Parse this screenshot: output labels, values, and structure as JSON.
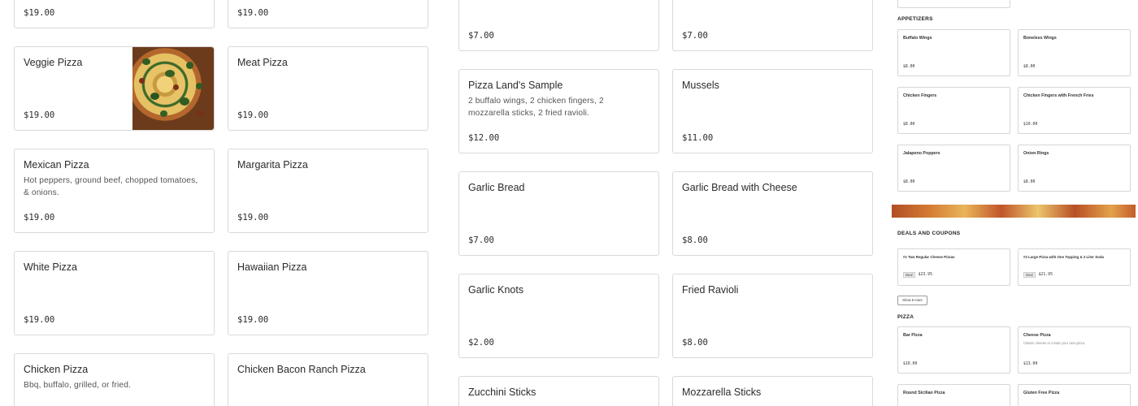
{
  "left_items": [
    {
      "name": "",
      "desc": "",
      "price": "$19.00"
    },
    {
      "name": "",
      "desc": "",
      "price": "$19.00"
    },
    {
      "name": "Veggie Pizza",
      "desc": "",
      "price": "$19.00"
    },
    {
      "name": "Meat Pizza",
      "desc": "",
      "price": "$19.00"
    },
    {
      "name": "Mexican Pizza",
      "desc": "Hot peppers, ground beef, chopped tomatoes, & onions.",
      "price": "$19.00"
    },
    {
      "name": "Margarita Pizza",
      "desc": "",
      "price": "$19.00"
    },
    {
      "name": "White Pizza",
      "desc": "",
      "price": "$19.00"
    },
    {
      "name": "Hawaiian Pizza",
      "desc": "",
      "price": "$19.00"
    },
    {
      "name": "Chicken Pizza",
      "desc": "Bbq, buffalo, grilled, or fried.",
      "price": ""
    },
    {
      "name": "Chicken Bacon Ranch Pizza",
      "desc": "",
      "price": ""
    }
  ],
  "middle_items": [
    {
      "name": "",
      "desc": "",
      "price": "$7.00"
    },
    {
      "name": "",
      "desc": "",
      "price": "$7.00"
    },
    {
      "name": "Pizza Land's Sample",
      "desc": "2 buffalo wings, 2 chicken fingers, 2 mozzarella sticks, 2 fried ravioli.",
      "price": "$12.00"
    },
    {
      "name": "Mussels",
      "desc": "",
      "price": "$11.00"
    },
    {
      "name": "Garlic Bread",
      "desc": "",
      "price": "$7.00"
    },
    {
      "name": "Garlic Bread with Cheese",
      "desc": "",
      "price": "$8.00"
    },
    {
      "name": "Garlic Knots",
      "desc": "",
      "price": "$2.00"
    },
    {
      "name": "Fried Ravioli",
      "desc": "",
      "price": "$8.00"
    },
    {
      "name": "Zucchini Sticks",
      "desc": "",
      "price": ""
    },
    {
      "name": "Mozzarella Sticks",
      "desc": "",
      "price": ""
    }
  ],
  "mini": {
    "appetizers_heading": "APPETIZERS",
    "appetizers": [
      {
        "name": "Buffalo Wings",
        "price": "$8.00"
      },
      {
        "name": "Boneless Wings",
        "price": "$8.00"
      },
      {
        "name": "Chicken Fingers",
        "price": "$8.00"
      },
      {
        "name": "Chicken Fingers with French Fries",
        "price": "$10.00"
      },
      {
        "name": "Jalapeno Poppers",
        "price": "$8.00"
      },
      {
        "name": "Onion Rings",
        "price": "$8.00"
      }
    ],
    "deals_heading": "DEALS AND COUPONS",
    "deals": [
      {
        "name": "#1 Two Regular Cheese Pizzas",
        "tag": "Deal",
        "price": "$23.95"
      },
      {
        "name": "#2 Large Pizza with One Topping & 2 Liter Soda",
        "tag": "Deal",
        "price": "$21.95"
      }
    ],
    "show_more": "Show 5 more",
    "pizza_heading": "PIZZA",
    "pizzas": [
      {
        "name": "Bar Pizza",
        "desc": "",
        "price": "$10.00"
      },
      {
        "name": "Cheese Pizza",
        "desc": "Classic cheese or create your own pizza.",
        "price": "$13.00"
      },
      {
        "name": "Round Sicilian Pizza",
        "desc": "",
        "price": ""
      },
      {
        "name": "Gluten Free Pizza",
        "desc": "",
        "price": ""
      }
    ]
  },
  "icons": {
    "veggie_image": "pizza-photo"
  }
}
